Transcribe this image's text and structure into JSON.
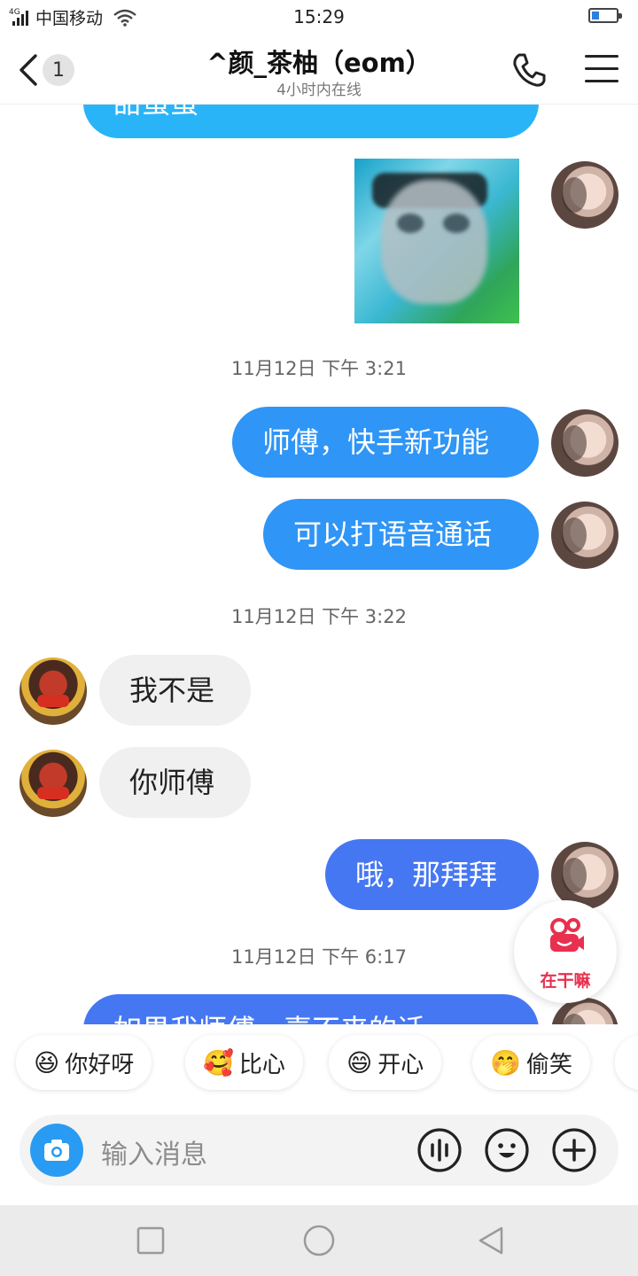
{
  "status": {
    "network": "4G",
    "carrier": "中国移动",
    "time": "15:29"
  },
  "header": {
    "unread_count": "1",
    "title": "^颜_茶柚（eom）",
    "subtitle": "4小时内在线"
  },
  "colors": {
    "bubble_out_light": "#2ab4f8",
    "bubble_out": "#2f95f6",
    "bubble_out_dark": "#4677f3",
    "accent_red": "#e8304f"
  },
  "chat": {
    "partial_top_text": "甜蛋蛋",
    "timestamps": [
      "11月12日 下午 3:21",
      "11月12日 下午 3:22",
      "11月12日 下午 6:17"
    ],
    "messages": [
      {
        "from": "me",
        "text": "师傅，快手新功能"
      },
      {
        "from": "me",
        "text": "可以打语音通话"
      },
      {
        "from": "other",
        "text": "我不是"
      },
      {
        "from": "other",
        "text": "你师傅"
      },
      {
        "from": "me",
        "text": "哦，那拜拜"
      },
      {
        "from": "me",
        "text": "如果我师傅，喜不来的话"
      }
    ]
  },
  "floating": {
    "label": "在干嘛"
  },
  "quick_replies": [
    {
      "emoji": "😆",
      "label": "你好呀"
    },
    {
      "emoji": "🥰",
      "label": "比心"
    },
    {
      "emoji": "😄",
      "label": "开心"
    },
    {
      "emoji": "🤭",
      "label": "偷笑"
    }
  ],
  "input": {
    "placeholder": "输入消息"
  },
  "icons": [
    "back-icon",
    "phone-icon",
    "menu-icon",
    "camera-icon",
    "voice-icon",
    "emoji-icon",
    "plus-icon",
    "square-icon",
    "circle-icon",
    "triangle-back-icon"
  ]
}
